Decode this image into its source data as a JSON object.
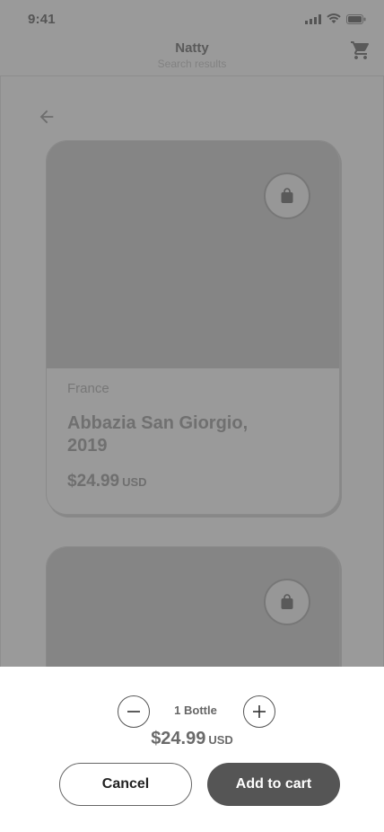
{
  "status_bar": {
    "time": "9:41"
  },
  "header": {
    "title": "Natty",
    "subtitle": "Search results"
  },
  "icons": {
    "cart": "cart-icon",
    "back": "arrow-left-icon",
    "bag": "shopping-bag-icon",
    "minus": "minus-icon",
    "plus": "plus-icon"
  },
  "products": [
    {
      "region": "France",
      "name": "Abbazia San Giorgio, 2019",
      "price": "$24.99",
      "currency": "USD"
    },
    {
      "region": "",
      "name": "",
      "price": "",
      "currency": ""
    }
  ],
  "sheet": {
    "quantity_label": "1 Bottle",
    "price": "$24.99",
    "currency": "USD",
    "cancel_label": "Cancel",
    "add_label": "Add to cart"
  },
  "colors": {
    "overlay": "#9a9a9a",
    "primary_button": "#555555",
    "sheet_background": "#ffffff"
  }
}
